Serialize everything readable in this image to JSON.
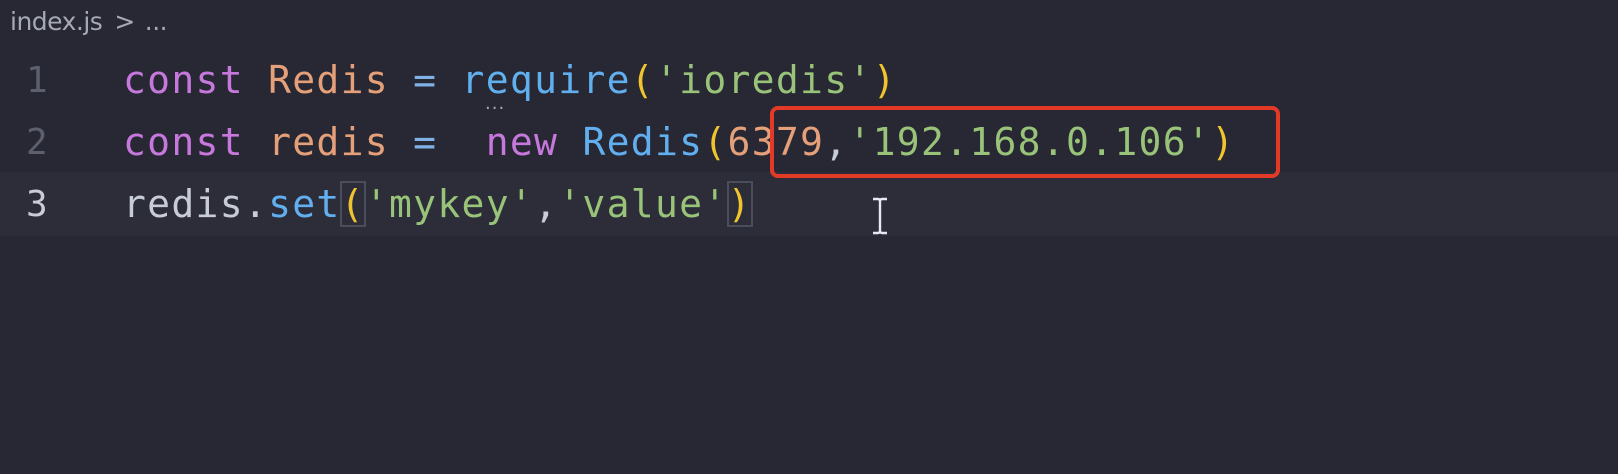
{
  "breadcrumb": {
    "file": "index.js",
    "separator": ">",
    "ellipsis": "..."
  },
  "lines": [
    {
      "number": "1",
      "tokens": [
        "const",
        " ",
        "Redis",
        " ",
        "=",
        " ",
        "require",
        "(",
        "'ioredis'",
        ")"
      ]
    },
    {
      "number": "2",
      "tokens": [
        "const",
        " ",
        "redis",
        " ",
        "=",
        "  ",
        "new",
        " ",
        "Redis",
        "(",
        "6379",
        ",",
        "'192.168.0.106'",
        ")"
      ]
    },
    {
      "number": "3",
      "tokens": [
        "redis",
        ".",
        "set",
        "(",
        "'mykey'",
        ",",
        "'value'",
        ")"
      ]
    }
  ],
  "colors": {
    "background": "#272833",
    "highlight_box": "#e23a27",
    "keyword": "#c678dd",
    "string": "#98c379",
    "function": "#61afef",
    "paren": "#f0c42e"
  },
  "hint": "..."
}
